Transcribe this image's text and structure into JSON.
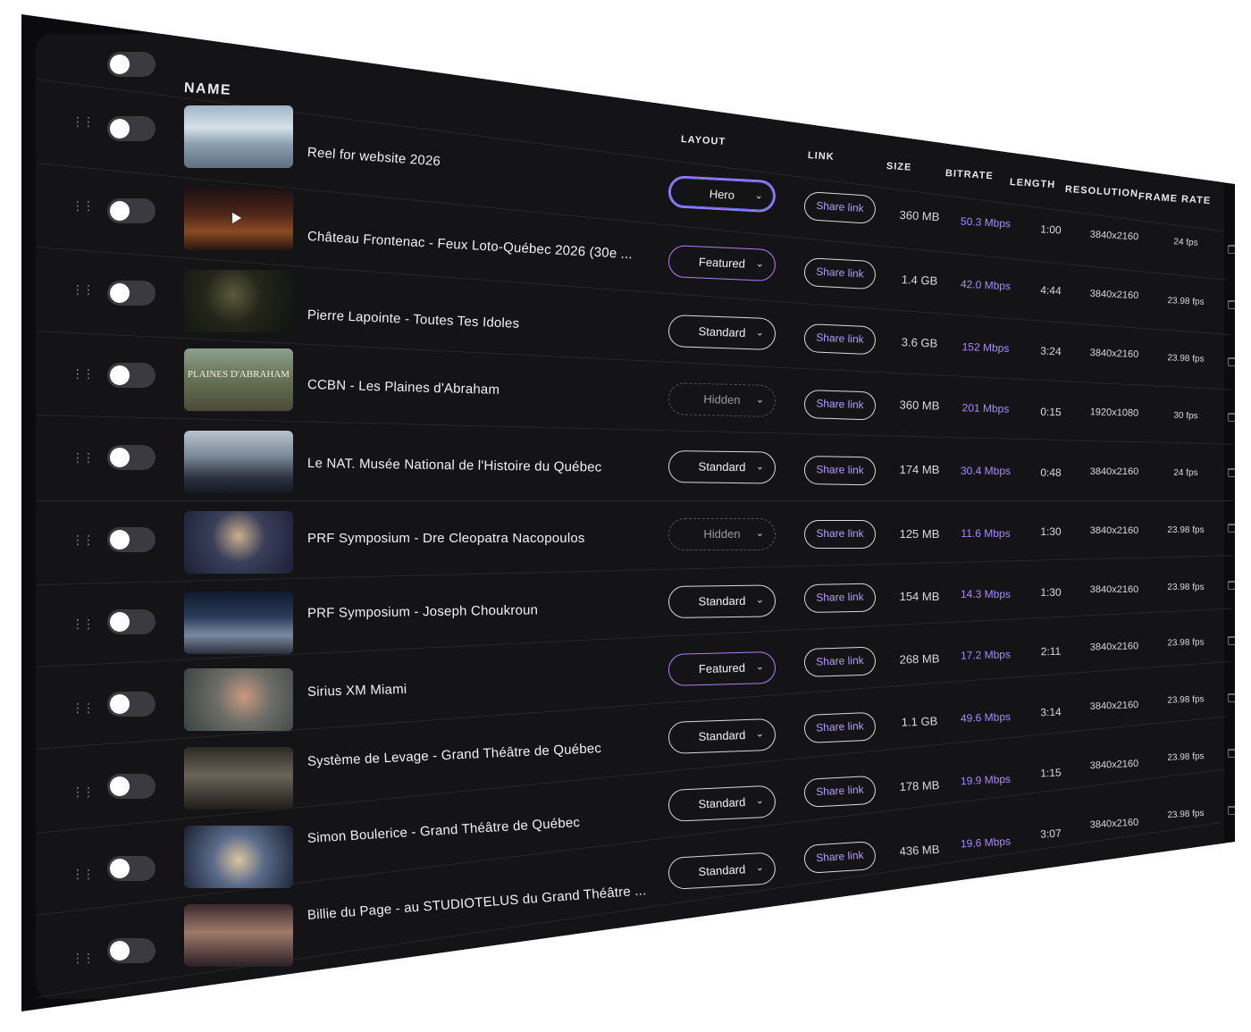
{
  "header": {
    "name": "NAME",
    "layout": "LAYOUT",
    "link": "LINK",
    "size": "SIZE",
    "bitrate": "BITRATE",
    "length": "LENGTH",
    "resolution": "RESOLUTION",
    "frame_rate": "FRAME RATE"
  },
  "rows": [
    {
      "title": "Reel for website 2026",
      "layout": "Hero",
      "link": "Share link",
      "size": "360 MB",
      "bitrate": "50.3 Mbps",
      "length": "1:00",
      "resolution": "3840x2160",
      "fps": "24 fps"
    },
    {
      "title": "Château Frontenac - Feux Loto-Québec 2026 (30e ...",
      "layout": "Featured",
      "link": "Share link",
      "size": "1.4 GB",
      "bitrate": "42.0 Mbps",
      "length": "4:44",
      "resolution": "3840x2160",
      "fps": "23.98 fps"
    },
    {
      "title": "Pierre Lapointe - Toutes Tes Idoles",
      "layout": "Standard",
      "link": "Share link",
      "size": "3.6 GB",
      "bitrate": "152 Mbps",
      "length": "3:24",
      "resolution": "3840x2160",
      "fps": "23.98 fps"
    },
    {
      "title": "CCBN - Les Plaines d'Abraham",
      "layout": "Hidden",
      "link": "Share link",
      "size": "360 MB",
      "bitrate": "201 Mbps",
      "length": "0:15",
      "resolution": "1920x1080",
      "fps": "30 fps",
      "thumb_text": "PLAINES D'ABRAHAM"
    },
    {
      "title": "Le NAT. Musée National de l'Histoire du Québec",
      "layout": "Standard",
      "link": "Share link",
      "size": "174 MB",
      "bitrate": "30.4 Mbps",
      "length": "0:48",
      "resolution": "3840x2160",
      "fps": "24 fps"
    },
    {
      "title": "PRF Symposium - Dre Cleopatra Nacopoulos",
      "layout": "Hidden",
      "link": "Share link",
      "size": "125 MB",
      "bitrate": "11.6 Mbps",
      "length": "1:30",
      "resolution": "3840x2160",
      "fps": "23.98 fps"
    },
    {
      "title": "PRF Symposium - Joseph Choukroun",
      "layout": "Standard",
      "link": "Share link",
      "size": "154 MB",
      "bitrate": "14.3 Mbps",
      "length": "1:30",
      "resolution": "3840x2160",
      "fps": "23.98 fps"
    },
    {
      "title": "Sirius XM Miami",
      "layout": "Featured",
      "link": "Share link",
      "size": "268 MB",
      "bitrate": "17.2 Mbps",
      "length": "2:11",
      "resolution": "3840x2160",
      "fps": "23.98 fps"
    },
    {
      "title": "Système de Levage - Grand Théâtre de Québec",
      "layout": "Standard",
      "link": "Share link",
      "size": "1.1 GB",
      "bitrate": "49.6 Mbps",
      "length": "3:14",
      "resolution": "3840x2160",
      "fps": "23.98 fps"
    },
    {
      "title": "Simon Boulerice - Grand Théâtre de Québec",
      "layout": "Standard",
      "link": "Share link",
      "size": "178 MB",
      "bitrate": "19.9 Mbps",
      "length": "1:15",
      "resolution": "3840x2160",
      "fps": "23.98 fps"
    },
    {
      "title": "Billie du Page - au STUDIOTELUS du Grand Théâtre ...",
      "layout": "Standard",
      "link": "Share link",
      "size": "436 MB",
      "bitrate": "19.6 Mbps",
      "length": "3:07",
      "resolution": "3840x2160",
      "fps": "23.98 fps"
    }
  ],
  "colors": {
    "background": "#141417",
    "accent": "#a889ff",
    "hero_border": "#9a7bff",
    "text": "#f2f2f4"
  }
}
